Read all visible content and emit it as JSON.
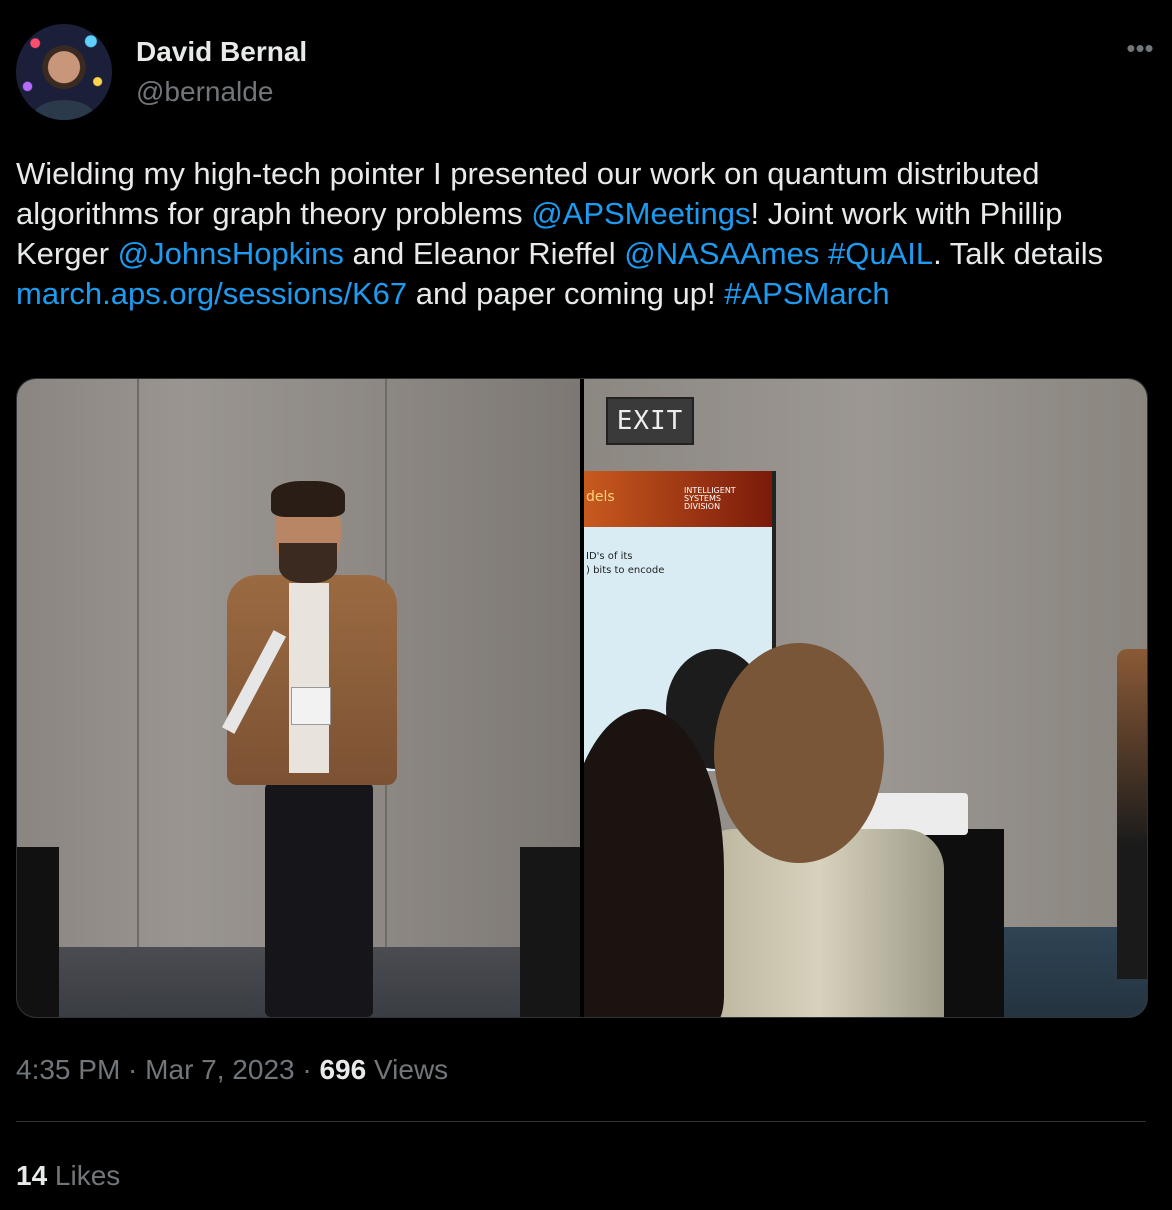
{
  "author": {
    "name": "David Bernal",
    "handle": "@bernalde"
  },
  "more_icon": "more-horizontal-icon",
  "tweet": {
    "segments": [
      {
        "text": "Wielding my high-tech pointer I presented our work on quantum distributed algorithms for graph theory problems ",
        "type": "text"
      },
      {
        "text": "@APSMeetings",
        "type": "mention"
      },
      {
        "text": "! Joint work with Phillip Kerger ",
        "type": "text"
      },
      {
        "text": "@JohnsHopkins",
        "type": "mention"
      },
      {
        "text": " and Eleanor Rieffel ",
        "type": "text"
      },
      {
        "text": "@NASAAmes",
        "type": "mention"
      },
      {
        "text": " ",
        "type": "text"
      },
      {
        "text": "#QuAIL",
        "type": "hashtag"
      },
      {
        "text": ". Talk details ",
        "type": "text"
      },
      {
        "text": "march.aps.org/sessions/K67",
        "type": "link"
      },
      {
        "text": " and paper coming up! ",
        "type": "text"
      },
      {
        "text": "#APSMarch",
        "type": "hashtag"
      }
    ]
  },
  "media": {
    "photo2": {
      "exit_sign": "EXIT",
      "slide_banner": "dels",
      "slide_logo_lines": [
        "INTELLIGENT",
        "SYSTEMS",
        "DIVISION"
      ],
      "slide_line1": "ID's of its",
      "slide_line2": ") bits to encode"
    }
  },
  "meta": {
    "time": "4:35 PM",
    "sep1": " · ",
    "date": "Mar 7, 2023",
    "sep2": " · ",
    "views_count": "696",
    "views_label": " Views"
  },
  "likes": {
    "count": "14",
    "label": " Likes"
  },
  "colors": {
    "background": "#000000",
    "text": "#e7e9ea",
    "secondary": "#71767b",
    "link": "#1d9bf0",
    "border": "#2f3336"
  }
}
